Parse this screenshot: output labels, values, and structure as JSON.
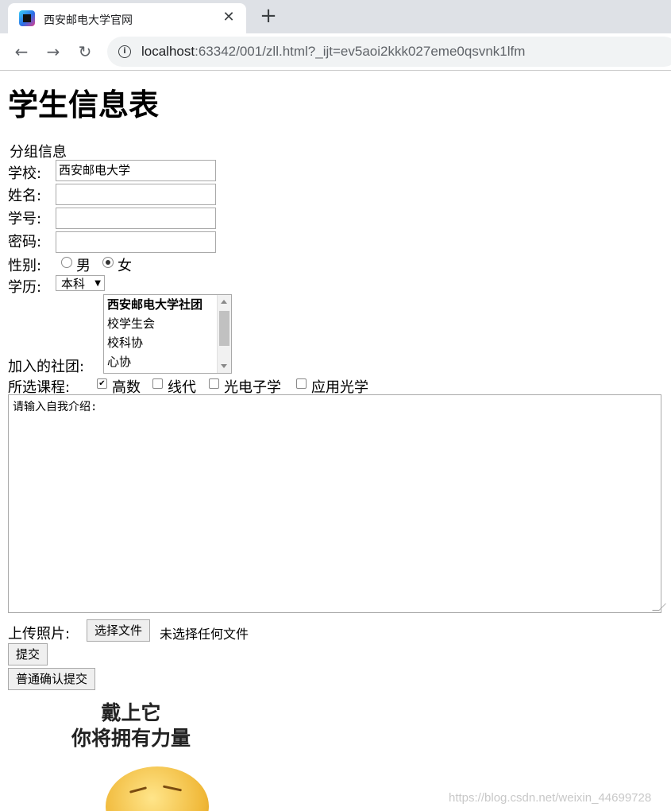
{
  "browser": {
    "tab_title": "西安邮电大学官网",
    "url_host": "localhost",
    "url_rest": ":63342/001/zll.html?_ijt=ev5aoi2kkk027eme0qsvnk1lfm"
  },
  "page": {
    "heading": "学生信息表",
    "legend": "分组信息",
    "fields": {
      "school_label": "学校:",
      "school_value": "西安邮电大学",
      "name_label": "姓名:",
      "name_value": "",
      "id_label": "学号:",
      "id_value": "",
      "password_label": "密码:",
      "password_value": ""
    },
    "gender": {
      "label": "性别:",
      "options": [
        "男",
        "女"
      ],
      "selected": "女"
    },
    "education": {
      "label": "学历:",
      "selected": "本科"
    },
    "clubs": {
      "label": "加入的社团:",
      "options": [
        "西安邮电大学社团",
        "校学生会",
        "校科协",
        "心协"
      ],
      "selected": "西安邮电大学社团"
    },
    "courses": {
      "label": "所选课程:",
      "options": [
        "高数",
        "线代",
        "光电子学",
        "应用光学"
      ],
      "checked": [
        "高数"
      ]
    },
    "intro": {
      "placeholder": "请输入自我介绍:"
    },
    "upload": {
      "label": "上传照片:",
      "button": "选择文件",
      "status": "未选择任何文件"
    },
    "submit_label": "提交",
    "confirm_submit_label": "普通确认提交",
    "meme": {
      "line1": "戴上它",
      "line2": "你将拥有力量"
    },
    "watermark": "https://blog.csdn.net/weixin_44699728"
  }
}
